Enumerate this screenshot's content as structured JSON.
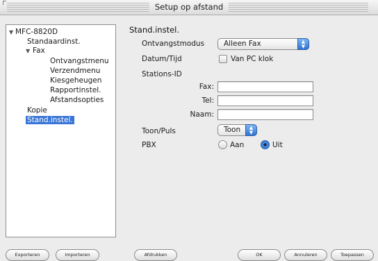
{
  "window": {
    "title": "Setup op afstand"
  },
  "tree": {
    "items": [
      {
        "label": "MFC-8820D",
        "level": 0,
        "expanded": true,
        "selected": false
      },
      {
        "label": "Standaardinst.",
        "level": 1,
        "expanded": false,
        "selected": false
      },
      {
        "label": "Fax",
        "level": 1,
        "expanded": true,
        "selected": false
      },
      {
        "label": "Ontvangstmenu",
        "level": 2,
        "expanded": false,
        "selected": false
      },
      {
        "label": "Verzendmenu",
        "level": 2,
        "expanded": false,
        "selected": false
      },
      {
        "label": "Kiesgeheugen",
        "level": 2,
        "expanded": false,
        "selected": false
      },
      {
        "label": "Rapportinstel.",
        "level": 2,
        "expanded": false,
        "selected": false
      },
      {
        "label": "Afstandsopties",
        "level": 2,
        "expanded": false,
        "selected": false
      },
      {
        "label": "Kopie",
        "level": 1,
        "expanded": false,
        "selected": false
      },
      {
        "label": "Stand.instel.",
        "level": 1,
        "expanded": false,
        "selected": true
      }
    ]
  },
  "main": {
    "section_title": "Stand.instel.",
    "ontvangstmodus": {
      "label": "Ontvangstmodus",
      "value": "Alleen Fax"
    },
    "datum_tijd": {
      "label": "Datum/Tijd",
      "checkbox_label": "Van PC klok",
      "checked": false
    },
    "stations_id": {
      "label": "Stations-ID",
      "fax_label": "Fax:",
      "fax_value": "",
      "tel_label": "Tel:",
      "tel_value": "",
      "naam_label": "Naam:",
      "naam_value": ""
    },
    "toon_puls": {
      "label": "Toon/Puls",
      "value": "Toon"
    },
    "pbx": {
      "label": "PBX",
      "option_aan": "Aan",
      "option_uit": "Uit",
      "selected": "Uit"
    }
  },
  "buttons": {
    "exporteren": "Exporteren",
    "importeren": "Importeren",
    "afdrukken": "Afdrukken",
    "ok": "OK",
    "annuleren": "Annuleren",
    "toepassen": "Toepassen"
  },
  "icons": {
    "tree_expanded": "disclosure-triangle-down-icon",
    "popup_arrows": "up-down-arrows-icon"
  },
  "colors": {
    "selection": "#3875d7",
    "accent": "#2f73d1"
  }
}
